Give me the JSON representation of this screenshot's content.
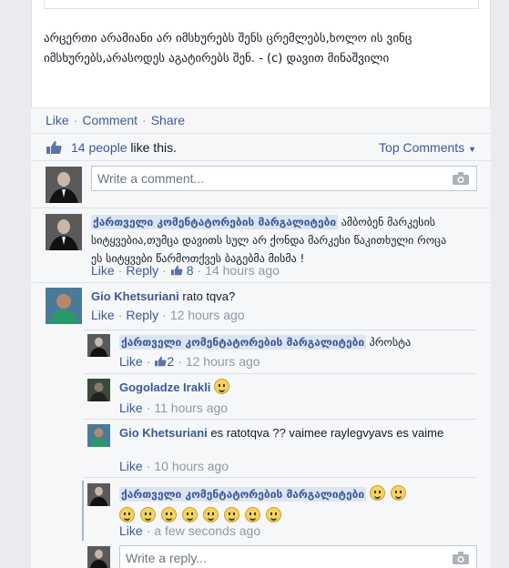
{
  "post": {
    "text": "არცერთი არამიანი არ იმსხურებს შენს ცრემლებს,ხოლო ის ვინც იმსხურებს,არასოდეს აგატირებს შენ. - (c) დავით მინაშვილი"
  },
  "actions": {
    "like": "Like",
    "comment": "Comment",
    "share": "Share"
  },
  "likes": {
    "count_text": "14 people",
    "suffix": " like this."
  },
  "top_comments": "Top Comments",
  "comment_placeholder": "Write a comment...",
  "reply_placeholder": "Write a reply...",
  "comments": [
    {
      "author": "ქართველი კომენტატორების მარგალიტები",
      "text": "ამბობენ მარკესის სიტყვებია,თუმცა დავითს სულ არ ქონდა მარკესი წაკითხული როცა ეს სიტყვები წარმოთქვეს ბაგებმა მისმა !",
      "like": "Like",
      "reply": "Reply",
      "likes": "8",
      "time": "14 hours ago"
    },
    {
      "author": "Gio Khetsuriani",
      "text": "rato tqva?",
      "like": "Like",
      "reply": "Reply",
      "time": "12 hours ago"
    }
  ],
  "replies": [
    {
      "author": "ქართველი კომენტატორების მარგალიტები",
      "text": "პროსტა",
      "like": "Like",
      "likes": "2",
      "time": "12 hours ago"
    },
    {
      "author": "Gogoladze Irakli",
      "like": "Like",
      "time": "11 hours ago"
    },
    {
      "author": "Gio Khetsuriani",
      "text": "es ratotqva ?? vaimee raylegvyavs es vaime",
      "like": "Like",
      "time": "10 hours ago"
    },
    {
      "author": "ქართველი კომენტატორების მარგალიტები",
      "like": "Like",
      "time": "a few seconds ago"
    }
  ],
  "colors": {
    "link": "#3b5998",
    "meta": "#9197a3",
    "bg": "#f6f7f9"
  }
}
